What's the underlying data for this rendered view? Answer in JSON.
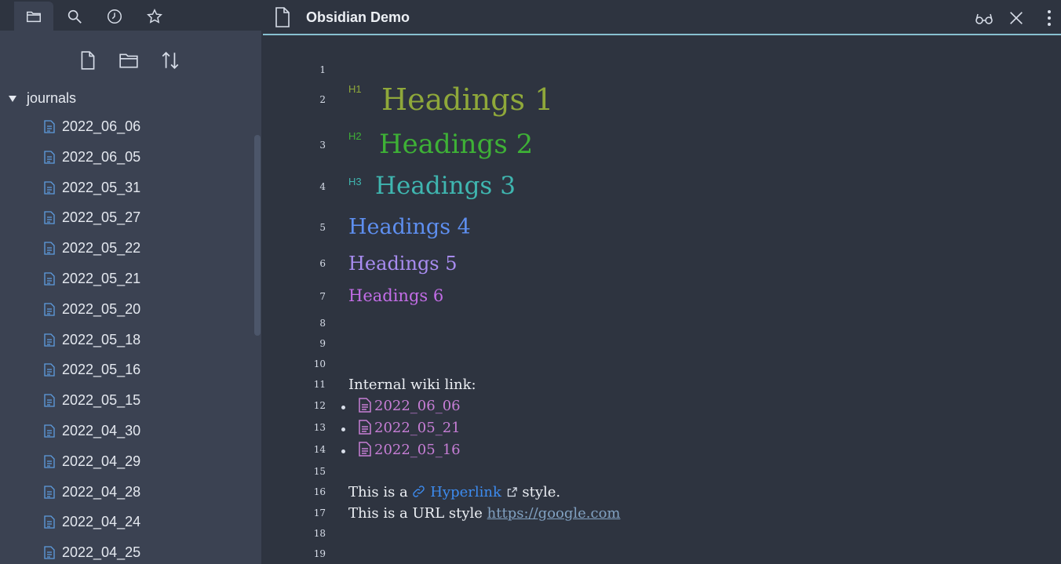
{
  "sidebar": {
    "tabs": [
      {
        "name": "files",
        "icon": "folder-icon"
      },
      {
        "name": "search",
        "icon": "search-icon"
      },
      {
        "name": "recent",
        "icon": "clock-icon"
      },
      {
        "name": "starred",
        "icon": "star-icon"
      }
    ],
    "actions": [
      {
        "name": "new-note",
        "icon": "new-file-icon"
      },
      {
        "name": "new-folder",
        "icon": "new-folder-icon"
      },
      {
        "name": "sort",
        "icon": "sort-icon"
      }
    ],
    "folder": {
      "name": "journals",
      "expanded": true
    },
    "files": [
      "2022_06_06",
      "2022_06_05",
      "2022_05_31",
      "2022_05_27",
      "2022_05_22",
      "2022_05_21",
      "2022_05_20",
      "2022_05_18",
      "2022_05_16",
      "2022_05_15",
      "2022_04_30",
      "2022_04_29",
      "2022_04_28",
      "2022_04_24",
      "2022_04_25"
    ]
  },
  "editor": {
    "title": "Obsidian Demo",
    "header_icons": [
      "reading-view-icon",
      "close-icon",
      "more-options-icon"
    ],
    "line_numbers": [
      "1",
      "2",
      "3",
      "4",
      "5",
      "6",
      "7",
      "8",
      "9",
      "10",
      "11",
      "12",
      "13",
      "14",
      "15",
      "16",
      "17",
      "18",
      "19"
    ],
    "headings": {
      "h1": {
        "marker": "H1",
        "text": "Headings 1"
      },
      "h2": {
        "marker": "H2",
        "text": "Headings 2"
      },
      "h3": {
        "marker": "H3",
        "text": "Headings 3"
      },
      "h4": {
        "text": "Headings 4"
      },
      "h5": {
        "text": "Headings 5"
      },
      "h6": {
        "text": "Headings 6"
      }
    },
    "internal_link_label": "Internal wiki link:",
    "wiki_links": [
      "2022_06_06",
      "2022_05_21",
      "2022_05_16"
    ],
    "hyperlink_line": {
      "prefix": "This is a ",
      "link": "Hyperlink",
      "suffix": " style."
    },
    "url_line": {
      "prefix": "This is a URL style ",
      "url": "https://google.com"
    }
  },
  "colors": {
    "accent": "#88c0d0",
    "h1": "#8fa83a",
    "h2": "#3eb136",
    "h3": "#3fb6b0",
    "h4": "#5e8ff0",
    "h5": "#a88cf0",
    "h6": "#c26de6",
    "file_icon": "#5e9de0",
    "wiki_link": "#c77ed6",
    "hyperlink": "#3d8cf0"
  }
}
